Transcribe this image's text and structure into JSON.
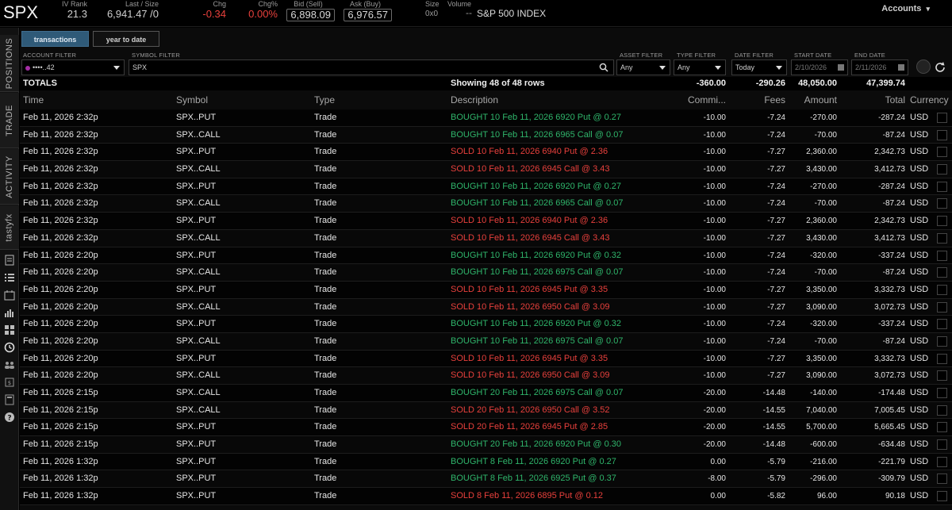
{
  "header": {
    "symbol": "SPX",
    "iv_rank_label": "IV Rank",
    "iv_rank": "21.3",
    "last_size_label": "Last / Size",
    "last_size": "6,941.47 /0",
    "chg_label": "Chg",
    "chg": "-0.34",
    "chg_pct_label": "Chg%",
    "chg_pct": "0.00%",
    "bid_label": "Bid (Sell)",
    "bid": "6,898.09",
    "ask_label": "Ask (Buy)",
    "ask": "6,976.57",
    "size_label": "Size",
    "size": "0x0",
    "volume_label": "Volume",
    "volume": "--",
    "index_name": "S&P 500 INDEX",
    "accounts": "Accounts"
  },
  "rail": {
    "tabs": [
      "POSITIONS",
      "TRADE",
      "ACTIVITY",
      "tastyfx"
    ],
    "icons": [
      "document-icon",
      "list-icon",
      "calendar-icon",
      "chart-icon",
      "grid-icon",
      "history-icon",
      "people-icon",
      "watchlist-icon",
      "calculator-icon",
      "help-icon"
    ]
  },
  "tabs": {
    "transactions": "transactions",
    "year_to_date": "year to date"
  },
  "filters": {
    "account_label": "ACCOUNT FILTER",
    "account_value": "••••..42",
    "symbol_label": "SYMBOL FILTER",
    "symbol_value": "SPX",
    "asset_label": "ASSET FILTER",
    "asset_value": "Any",
    "type_label": "TYPE FILTER",
    "type_value": "Any",
    "date_label": "DATE FILTER",
    "date_value": "Today",
    "start_label": "START DATE",
    "start_value": "2/10/2026",
    "end_label": "END DATE",
    "end_value": "2/11/2026"
  },
  "colors": {
    "buy": "#2fb56b",
    "sell": "#e8403c"
  },
  "totals": {
    "label": "TOTALS",
    "showing": "Showing 48 of 48 rows",
    "commission": "-360.00",
    "fees": "-290.26",
    "amount": "48,050.00",
    "total": "47,399.74"
  },
  "columns": {
    "time": "Time",
    "symbol": "Symbol",
    "type": "Type",
    "description": "Description",
    "commission": "Commi...",
    "fees": "Fees",
    "amount": "Amount",
    "total": "Total",
    "currency": "Currency"
  },
  "rows": [
    {
      "time": "Feb 11, 2026  2:32p",
      "symbol": "SPX..PUT",
      "type": "Trade",
      "desc": "BOUGHT 10 Feb 11, 2026 6920 Put @ 0.27",
      "side": "buy",
      "comm": "-10.00",
      "fees": "-7.24",
      "amount": "-270.00",
      "total": "-287.24",
      "cur": "USD"
    },
    {
      "time": "Feb 11, 2026  2:32p",
      "symbol": "SPX..CALL",
      "type": "Trade",
      "desc": "BOUGHT 10 Feb 11, 2026 6965 Call @ 0.07",
      "side": "buy",
      "comm": "-10.00",
      "fees": "-7.24",
      "amount": "-70.00",
      "total": "-87.24",
      "cur": "USD"
    },
    {
      "time": "Feb 11, 2026  2:32p",
      "symbol": "SPX..PUT",
      "type": "Trade",
      "desc": "SOLD 10 Feb 11, 2026 6940 Put @ 2.36",
      "side": "sell",
      "comm": "-10.00",
      "fees": "-7.27",
      "amount": "2,360.00",
      "total": "2,342.73",
      "cur": "USD"
    },
    {
      "time": "Feb 11, 2026  2:32p",
      "symbol": "SPX..CALL",
      "type": "Trade",
      "desc": "SOLD 10 Feb 11, 2026 6945 Call @ 3.43",
      "side": "sell",
      "comm": "-10.00",
      "fees": "-7.27",
      "amount": "3,430.00",
      "total": "3,412.73",
      "cur": "USD"
    },
    {
      "time": "Feb 11, 2026  2:32p",
      "symbol": "SPX..PUT",
      "type": "Trade",
      "desc": "BOUGHT 10 Feb 11, 2026 6920 Put @ 0.27",
      "side": "buy",
      "comm": "-10.00",
      "fees": "-7.24",
      "amount": "-270.00",
      "total": "-287.24",
      "cur": "USD"
    },
    {
      "time": "Feb 11, 2026  2:32p",
      "symbol": "SPX..CALL",
      "type": "Trade",
      "desc": "BOUGHT 10 Feb 11, 2026 6965 Call @ 0.07",
      "side": "buy",
      "comm": "-10.00",
      "fees": "-7.24",
      "amount": "-70.00",
      "total": "-87.24",
      "cur": "USD"
    },
    {
      "time": "Feb 11, 2026  2:32p",
      "symbol": "SPX..PUT",
      "type": "Trade",
      "desc": "SOLD 10 Feb 11, 2026 6940 Put @ 2.36",
      "side": "sell",
      "comm": "-10.00",
      "fees": "-7.27",
      "amount": "2,360.00",
      "total": "2,342.73",
      "cur": "USD"
    },
    {
      "time": "Feb 11, 2026  2:32p",
      "symbol": "SPX..CALL",
      "type": "Trade",
      "desc": "SOLD 10 Feb 11, 2026 6945 Call @ 3.43",
      "side": "sell",
      "comm": "-10.00",
      "fees": "-7.27",
      "amount": "3,430.00",
      "total": "3,412.73",
      "cur": "USD"
    },
    {
      "time": "Feb 11, 2026  2:20p",
      "symbol": "SPX..PUT",
      "type": "Trade",
      "desc": "BOUGHT 10 Feb 11, 2026 6920 Put @ 0.32",
      "side": "buy",
      "comm": "-10.00",
      "fees": "-7.24",
      "amount": "-320.00",
      "total": "-337.24",
      "cur": "USD"
    },
    {
      "time": "Feb 11, 2026  2:20p",
      "symbol": "SPX..CALL",
      "type": "Trade",
      "desc": "BOUGHT 10 Feb 11, 2026 6975 Call @ 0.07",
      "side": "buy",
      "comm": "-10.00",
      "fees": "-7.24",
      "amount": "-70.00",
      "total": "-87.24",
      "cur": "USD"
    },
    {
      "time": "Feb 11, 2026  2:20p",
      "symbol": "SPX..PUT",
      "type": "Trade",
      "desc": "SOLD 10 Feb 11, 2026 6945 Put @ 3.35",
      "side": "sell",
      "comm": "-10.00",
      "fees": "-7.27",
      "amount": "3,350.00",
      "total": "3,332.73",
      "cur": "USD"
    },
    {
      "time": "Feb 11, 2026  2:20p",
      "symbol": "SPX..CALL",
      "type": "Trade",
      "desc": "SOLD 10 Feb 11, 2026 6950 Call @ 3.09",
      "side": "sell",
      "comm": "-10.00",
      "fees": "-7.27",
      "amount": "3,090.00",
      "total": "3,072.73",
      "cur": "USD"
    },
    {
      "time": "Feb 11, 2026  2:20p",
      "symbol": "SPX..PUT",
      "type": "Trade",
      "desc": "BOUGHT 10 Feb 11, 2026 6920 Put @ 0.32",
      "side": "buy",
      "comm": "-10.00",
      "fees": "-7.24",
      "amount": "-320.00",
      "total": "-337.24",
      "cur": "USD"
    },
    {
      "time": "Feb 11, 2026  2:20p",
      "symbol": "SPX..CALL",
      "type": "Trade",
      "desc": "BOUGHT 10 Feb 11, 2026 6975 Call @ 0.07",
      "side": "buy",
      "comm": "-10.00",
      "fees": "-7.24",
      "amount": "-70.00",
      "total": "-87.24",
      "cur": "USD"
    },
    {
      "time": "Feb 11, 2026  2:20p",
      "symbol": "SPX..PUT",
      "type": "Trade",
      "desc": "SOLD 10 Feb 11, 2026 6945 Put @ 3.35",
      "side": "sell",
      "comm": "-10.00",
      "fees": "-7.27",
      "amount": "3,350.00",
      "total": "3,332.73",
      "cur": "USD"
    },
    {
      "time": "Feb 11, 2026  2:20p",
      "symbol": "SPX..CALL",
      "type": "Trade",
      "desc": "SOLD 10 Feb 11, 2026 6950 Call @ 3.09",
      "side": "sell",
      "comm": "-10.00",
      "fees": "-7.27",
      "amount": "3,090.00",
      "total": "3,072.73",
      "cur": "USD"
    },
    {
      "time": "Feb 11, 2026  2:15p",
      "symbol": "SPX..CALL",
      "type": "Trade",
      "desc": "BOUGHT 20 Feb 11, 2026 6975 Call @ 0.07",
      "side": "buy",
      "comm": "-20.00",
      "fees": "-14.48",
      "amount": "-140.00",
      "total": "-174.48",
      "cur": "USD"
    },
    {
      "time": "Feb 11, 2026  2:15p",
      "symbol": "SPX..CALL",
      "type": "Trade",
      "desc": "SOLD 20 Feb 11, 2026 6950 Call @ 3.52",
      "side": "sell",
      "comm": "-20.00",
      "fees": "-14.55",
      "amount": "7,040.00",
      "total": "7,005.45",
      "cur": "USD"
    },
    {
      "time": "Feb 11, 2026  2:15p",
      "symbol": "SPX..PUT",
      "type": "Trade",
      "desc": "SOLD 20 Feb 11, 2026 6945 Put @ 2.85",
      "side": "sell",
      "comm": "-20.00",
      "fees": "-14.55",
      "amount": "5,700.00",
      "total": "5,665.45",
      "cur": "USD"
    },
    {
      "time": "Feb 11, 2026  2:15p",
      "symbol": "SPX..PUT",
      "type": "Trade",
      "desc": "BOUGHT 20 Feb 11, 2026 6920 Put @ 0.30",
      "side": "buy",
      "comm": "-20.00",
      "fees": "-14.48",
      "amount": "-600.00",
      "total": "-634.48",
      "cur": "USD"
    },
    {
      "time": "Feb 11, 2026  1:32p",
      "symbol": "SPX..PUT",
      "type": "Trade",
      "desc": "BOUGHT 8 Feb 11, 2026 6920 Put @ 0.27",
      "side": "buy",
      "comm": "0.00",
      "fees": "-5.79",
      "amount": "-216.00",
      "total": "-221.79",
      "cur": "USD"
    },
    {
      "time": "Feb 11, 2026  1:32p",
      "symbol": "SPX..PUT",
      "type": "Trade",
      "desc": "BOUGHT 8 Feb 11, 2026 6925 Put @ 0.37",
      "side": "buy",
      "comm": "-8.00",
      "fees": "-5.79",
      "amount": "-296.00",
      "total": "-309.79",
      "cur": "USD"
    },
    {
      "time": "Feb 11, 2026  1:32p",
      "symbol": "SPX..PUT",
      "type": "Trade",
      "desc": "SOLD 8 Feb 11, 2026 6895 Put @ 0.12",
      "side": "sell",
      "comm": "0.00",
      "fees": "-5.82",
      "amount": "96.00",
      "total": "90.18",
      "cur": "USD"
    }
  ]
}
